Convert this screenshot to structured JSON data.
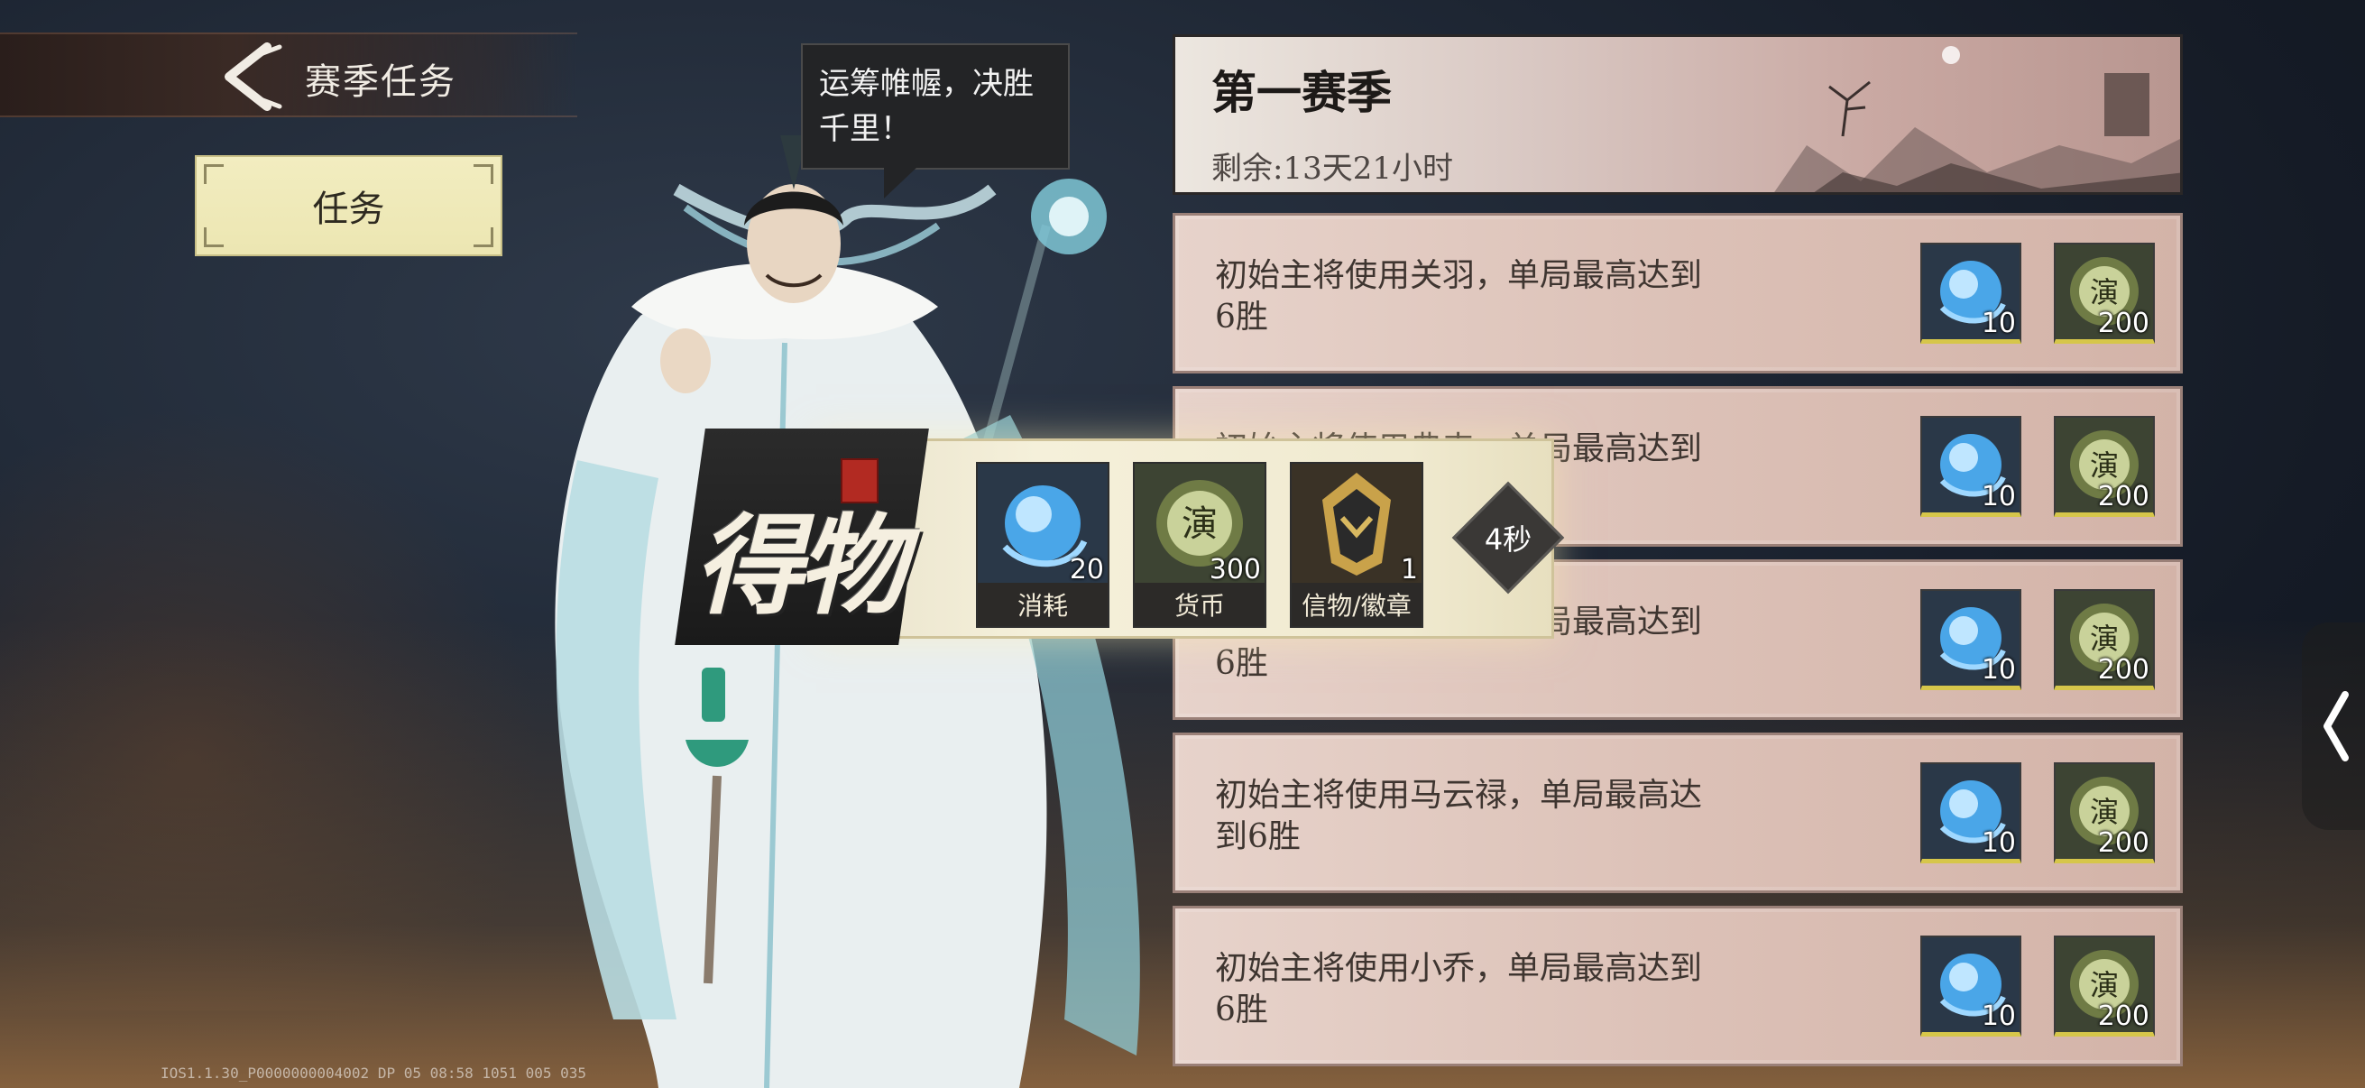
{
  "header": {
    "title": "赛季任务"
  },
  "tabs": [
    {
      "label": "任务",
      "selected": true
    }
  ],
  "speech": {
    "text": "运筹帷幄，决胜千里！"
  },
  "season": {
    "title": "第一赛季",
    "remaining": "剩余:13天21小时"
  },
  "tasks": [
    {
      "desc": "初始主将使用关羽，单局最高达到6胜",
      "rewards": [
        {
          "icon": "blue-orb-icon",
          "count": "10"
        },
        {
          "icon": "yan-coin-icon",
          "count": "200"
        }
      ]
    },
    {
      "desc": "初始主将使用典韦，单局最高达到6胜",
      "rewards": [
        {
          "icon": "blue-orb-icon",
          "count": "10"
        },
        {
          "icon": "yan-coin-icon",
          "count": "200"
        }
      ]
    },
    {
      "desc": "初始主将使用周瑜，单局最高达到6胜",
      "rewards": [
        {
          "icon": "blue-orb-icon",
          "count": "10"
        },
        {
          "icon": "yan-coin-icon",
          "count": "200"
        }
      ]
    },
    {
      "desc": "初始主将使用马云禄，单局最高达到6胜",
      "rewards": [
        {
          "icon": "blue-orb-icon",
          "count": "10"
        },
        {
          "icon": "yan-coin-icon",
          "count": "200"
        }
      ]
    },
    {
      "desc": "初始主将使用小乔，单局最高达到6胜",
      "rewards": [
        {
          "icon": "blue-orb-icon",
          "count": "10"
        },
        {
          "icon": "yan-coin-icon",
          "count": "200"
        }
      ]
    }
  ],
  "popup": {
    "title": "得物",
    "items": [
      {
        "icon": "blue-orb-icon",
        "count": "20",
        "label": "消耗"
      },
      {
        "icon": "yan-coin-icon",
        "count": "300",
        "label": "货币"
      },
      {
        "icon": "badge-icon",
        "count": "1",
        "label": "信物/徽章"
      }
    ],
    "timer": "4秒"
  },
  "build_info": "IOS1.1.30_P0000000004002 DP 05 08:58 1051 005 035",
  "colors": {
    "accent_yellow": "#d6c64a",
    "task_bg": "#dcc1b7",
    "tab_bg": "#ece6b2",
    "seal_red": "#b22a22"
  }
}
